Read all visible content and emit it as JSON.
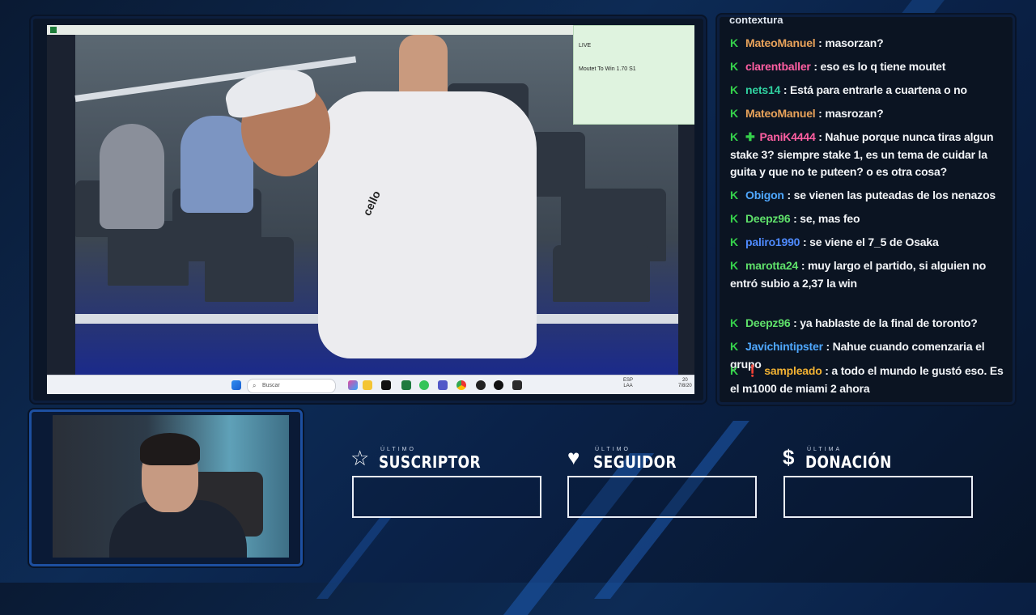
{
  "browser": {
    "address_label": ""
  },
  "overlay_note": {
    "line1": "LIVE",
    "line2": "Moutet To Win 1.70 S1"
  },
  "video": {
    "shirt_logo": "cello"
  },
  "taskbar": {
    "search_placeholder": "Buscar",
    "lang": "ESP",
    "lang2": "LAA",
    "time": "20",
    "date": "7/8/20"
  },
  "chat": {
    "header": "contextura",
    "messages": [
      {
        "user": "MateoManuel",
        "color": "#e8a25a",
        "text": "masorzan?",
        "badge_extra": ""
      },
      {
        "user": "clarentballer",
        "color": "#ff5fa2",
        "text": "eso es lo q tiene moutet",
        "badge_extra": ""
      },
      {
        "user": "nets14",
        "color": "#30d1a0",
        "text": "Está para entrarle a cuartena o no",
        "badge_extra": ""
      },
      {
        "user": "MateoManuel",
        "color": "#e8a25a",
        "text": "masrozan?",
        "badge_extra": ""
      },
      {
        "user": "PaniK4444",
        "color": "#ff5fa2",
        "text": "Nahue porque nunca tiras algun stake 3? siempre stake 1, es un tema de cuidar la guita y que no te puteen? o es otra cosa?",
        "badge_extra": "✚"
      },
      {
        "user": "Obigon",
        "color": "#4fa8ff",
        "text": "se vienen las puteadas de los nenazos",
        "badge_extra": ""
      },
      {
        "user": "Deepz96",
        "color": "#5fe06a",
        "text": "se, mas feo",
        "badge_extra": ""
      },
      {
        "user": "paliro1990",
        "color": "#4f8bff",
        "text": "se viene el 7_5 de Osaka",
        "badge_extra": ""
      },
      {
        "user": "marotta24",
        "color": "#5fe06a",
        "text": "muy largo el partido, si alguien no entró subio a 2,37 la win",
        "badge_extra": ""
      },
      {
        "user": "Deepz96",
        "color": "#5fe06a",
        "text": "ya hablaste de la final de toronto?",
        "badge_extra": ""
      },
      {
        "user": "Javichintipster",
        "color": "#4fa8ff",
        "text": "Nahue cuando comenzaria el grupo",
        "badge_extra": ""
      },
      {
        "user": "sampleado",
        "color": "#f2b233",
        "text": "a todo el mundo le gustó eso. Es el m1000 de miami 2 ahora",
        "badge_extra": "❗"
      }
    ]
  },
  "stats": [
    {
      "small": "ÚLTIMO",
      "label": "SUSCRIPTOR",
      "icon": "star-icon",
      "value": ""
    },
    {
      "small": "ÚLTIMO",
      "label": "SEGUIDOR",
      "icon": "heart-icon",
      "value": ""
    },
    {
      "small": "ÚLTIMA",
      "label": "DONACIÓN",
      "icon": "dollar-icon",
      "value": ""
    }
  ],
  "colors": {
    "accent_blue": "#1e5bb3",
    "chat_k_badge": "#35d14b"
  }
}
